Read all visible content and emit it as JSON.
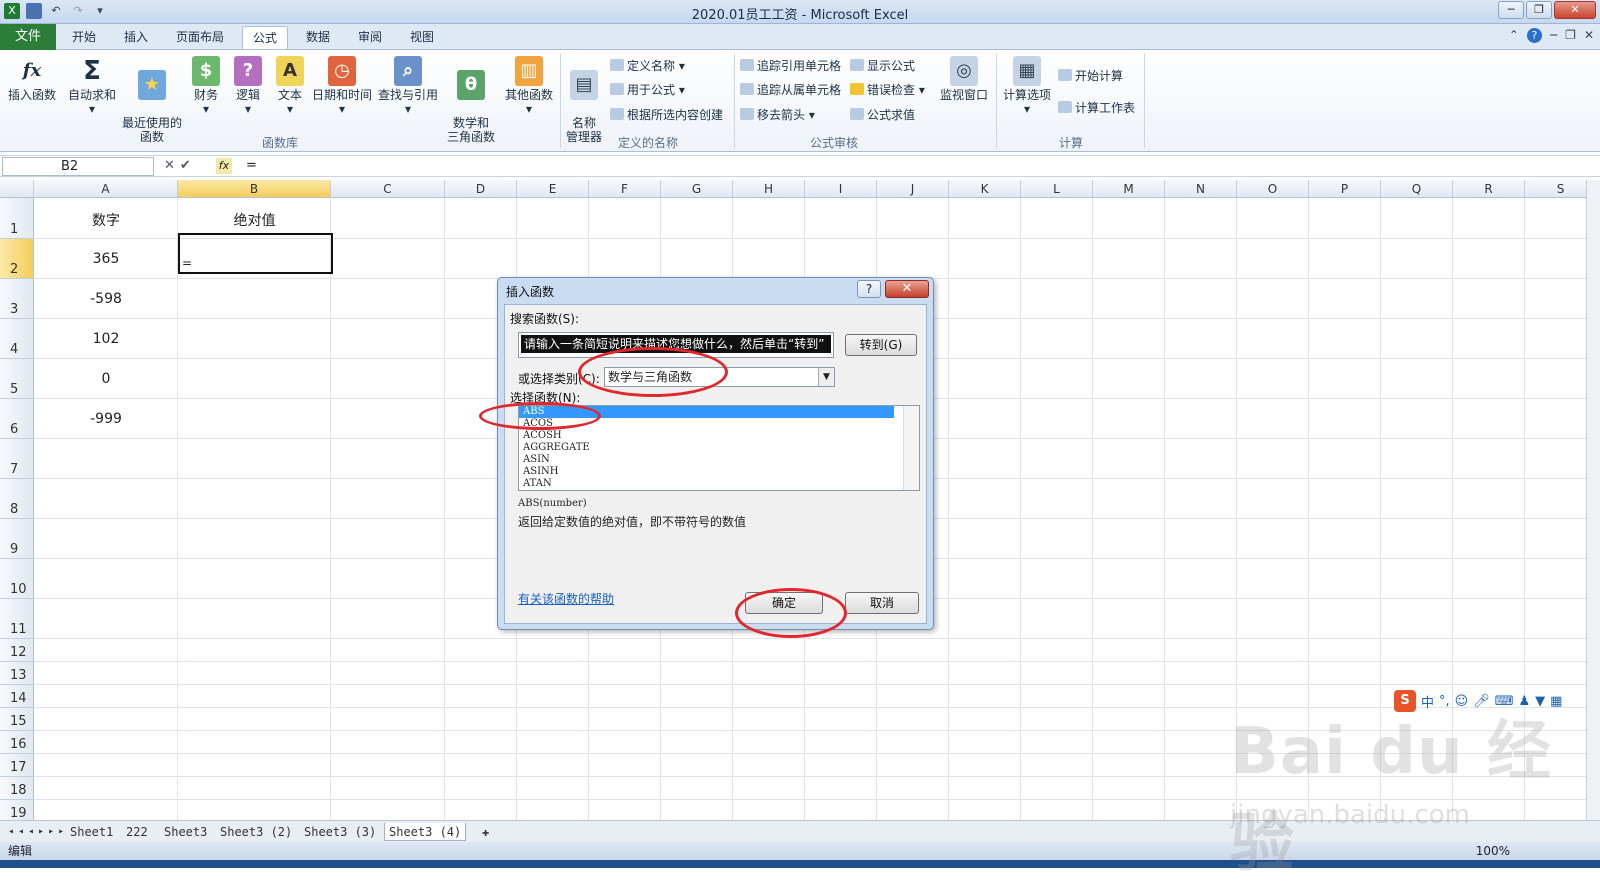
{
  "window": {
    "title": "2020.01员工工资 - Microsoft Excel"
  },
  "tabs": {
    "file": "文件",
    "items": [
      "开始",
      "插入",
      "页面布局",
      "公式",
      "数据",
      "审阅",
      "视图"
    ],
    "active": "公式"
  },
  "ribbon": {
    "insert_function": "插入函数",
    "autosum": "自动求和",
    "recent": "最近使用的\n函数",
    "financial": "财务",
    "logical": "逻辑",
    "text": "文本",
    "datetime": "日期和时间",
    "lookup": "查找与引用",
    "math": "数学和\n三角函数",
    "more": "其他函数",
    "name_manager": "名称\n管理器",
    "define_name": "定义名称",
    "use_in_formula": "用于公式",
    "create_from_selection": "根据所选内容创建",
    "trace_precedents": "追踪引用单元格",
    "trace_dependents": "追踪从属单元格",
    "remove_arrows": "移去箭头",
    "show_formulas": "显示公式",
    "error_checking": "错误检查",
    "evaluate_formula": "公式求值",
    "watch_window": "监视窗口",
    "calc_options": "计算选项",
    "calc_now": "开始计算",
    "calc_sheet": "计算工作表",
    "group_library": "函数库",
    "group_names": "定义的名称",
    "group_audit": "公式审核",
    "group_calc": "计算"
  },
  "formula_bar": {
    "name_box": "B2",
    "formula": "="
  },
  "grid": {
    "columns": [
      "A",
      "B",
      "C",
      "D",
      "E",
      "F",
      "G",
      "H",
      "I",
      "J",
      "K",
      "L",
      "M",
      "N",
      "O",
      "P",
      "Q",
      "R",
      "S"
    ],
    "rows": [
      "1",
      "2",
      "3",
      "4",
      "5",
      "6",
      "7",
      "8",
      "9",
      "10",
      "11",
      "12",
      "13",
      "14",
      "15",
      "16",
      "17",
      "18",
      "19"
    ],
    "cells": {
      "A1": "数字",
      "B1": "绝对值",
      "A2": "365",
      "A3": "-598",
      "A4": "102",
      "A5": "0",
      "A6": "-999",
      "B2": "="
    }
  },
  "sheets": [
    "Sheet1",
    "222",
    "Sheet3",
    "Sheet3 (2)",
    "Sheet3 (3)",
    "Sheet3 (4)"
  ],
  "active_sheet": "Sheet3 (4)",
  "status": {
    "mode": "编辑",
    "zoom": "100%"
  },
  "dialog": {
    "title": "插入函数",
    "search_label": "搜索函数(S):",
    "search_placeholder": "请输入一条简短说明来描述您想做什么，然后单击“转到”",
    "go_button": "转到(G)",
    "category_label": "或选择类别(C):",
    "category": "数学与三角函数",
    "list_label": "选择函数(N):",
    "functions": [
      "ABS",
      "ACOS",
      "ACOSH",
      "AGGREGATE",
      "ASIN",
      "ASINH",
      "ATAN"
    ],
    "selected": "ABS",
    "signature": "ABS(number)",
    "description": "返回给定数值的绝对值，即不带符号的数值",
    "help_link": "有关该函数的帮助",
    "ok": "确定",
    "cancel": "取消"
  },
  "ime": {
    "logo": "S",
    "label": "中"
  },
  "watermark": {
    "brand": "Bai du 经验",
    "url": "jingyan.baidu.com"
  }
}
